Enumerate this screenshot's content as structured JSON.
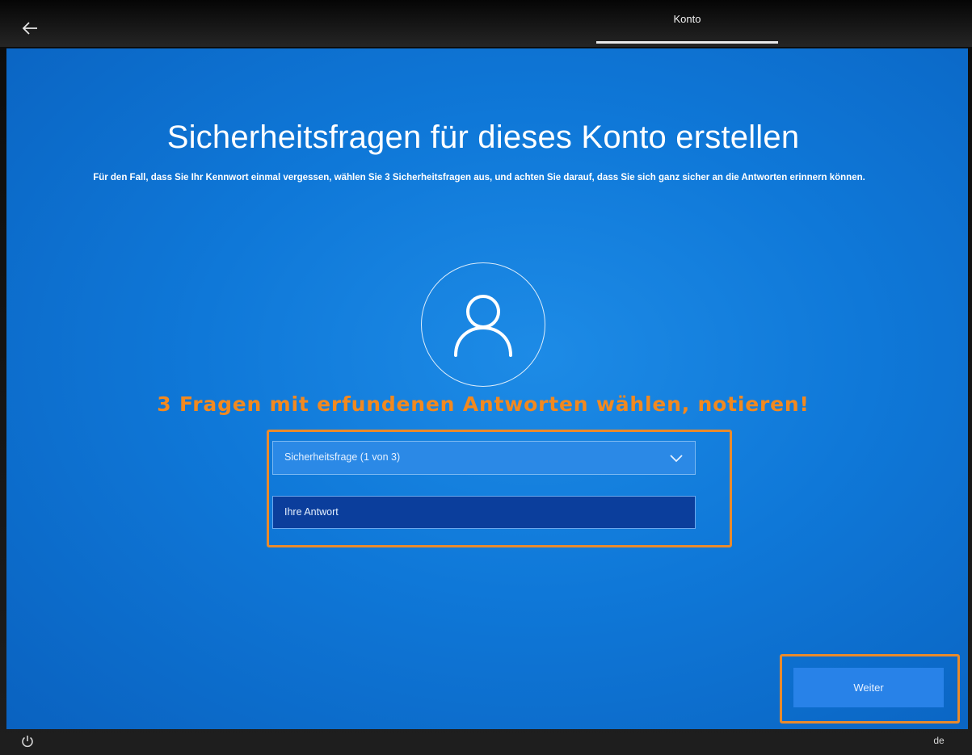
{
  "header": {
    "back_icon": "arrow-left-icon",
    "tab_label": "Konto"
  },
  "main": {
    "title": "Sicherheitsfragen für dieses Konto erstellen",
    "subtitle": "Für den Fall, dass Sie Ihr Kennwort einmal vergessen, wählen Sie 3 Sicherheitsfragen aus, und achten Sie darauf, dass Sie sich ganz sicher an die Antworten erinnern können.",
    "avatar_icon": "user-icon",
    "annotation": "3 Fragen mit erfundenen Antworten wählen, notieren!",
    "question_select": {
      "value": "Sicherheitsfrage (1 von 3)",
      "icon": "chevron-down-icon"
    },
    "answer_field": {
      "placeholder": "Ihre Antwort"
    },
    "next_button": "Weiter"
  },
  "footer": {
    "power_icon": "power-icon",
    "language": "de"
  },
  "colors": {
    "background": "#0f78d8",
    "annotation": "#f2891f",
    "highlight_border": "#e98a2c",
    "button": "#2882e8"
  }
}
